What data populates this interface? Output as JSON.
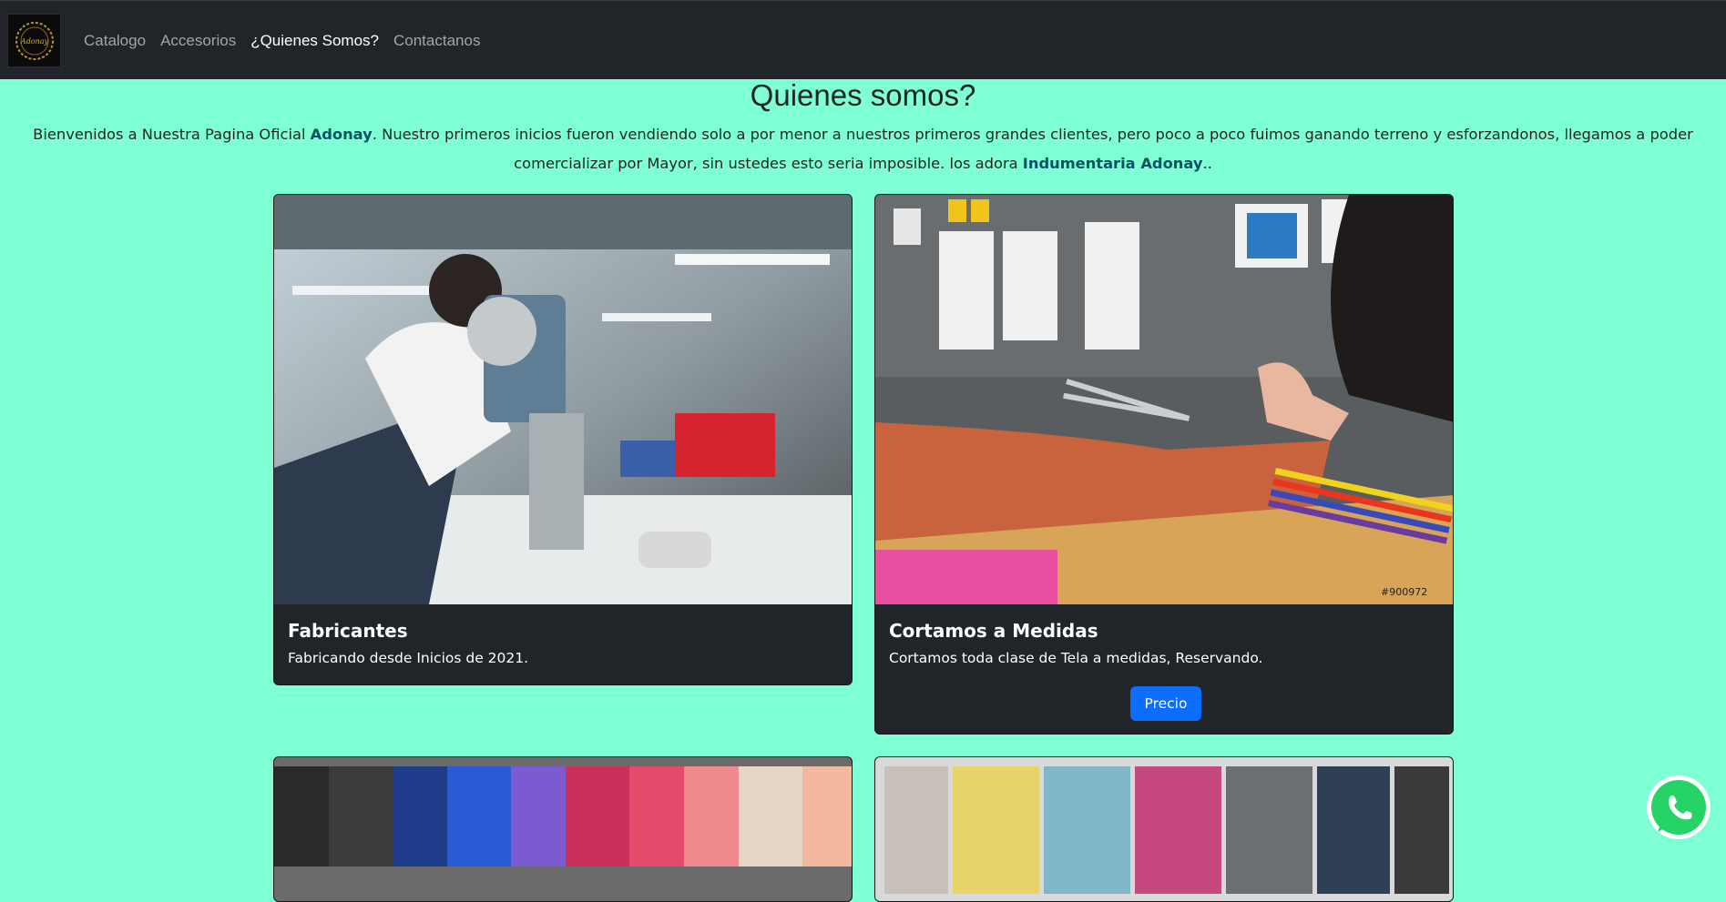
{
  "nav": {
    "logo_text": "Adonay",
    "links": [
      {
        "label": "Catalogo",
        "active": false
      },
      {
        "label": "Accesorios",
        "active": false
      },
      {
        "label": "¿Quienes Somos?",
        "active": true
      },
      {
        "label": "Contactanos",
        "active": false
      }
    ]
  },
  "main": {
    "title": "Quienes somos?",
    "intro": {
      "part1": "Bienvenidos a Nuestra Pagina Oficial ",
      "brand": "Adonay",
      "part2": ". Nuestro primeros inicios fueron vendiendo solo a por menor a nuestros primeros grandes clientes, pero poco a poco fuimos ganando terreno y esforzandonos, llegamos a poder comercializar por Mayor, sin ustedes esto seria imposible. los adora ",
      "brand2": "Indumentaria Adonay",
      "part3": ".."
    }
  },
  "cards": [
    {
      "title": "Fabricantes",
      "text": "Fabricando desde Inicios de 2021."
    },
    {
      "title": "Cortamos a Medidas",
      "text": "Cortamos toda clase de Tela a medidas, Reservando.",
      "button": "Precio",
      "image_code": "#900972"
    }
  ],
  "colors": {
    "page_bg": "#7fffd4",
    "navbar_bg": "#212529",
    "card_bg": "#212529",
    "button_primary": "#0d6efd",
    "brand_highlight": "#0b5164"
  },
  "icons": {
    "floating": "whatsapp-icon"
  }
}
